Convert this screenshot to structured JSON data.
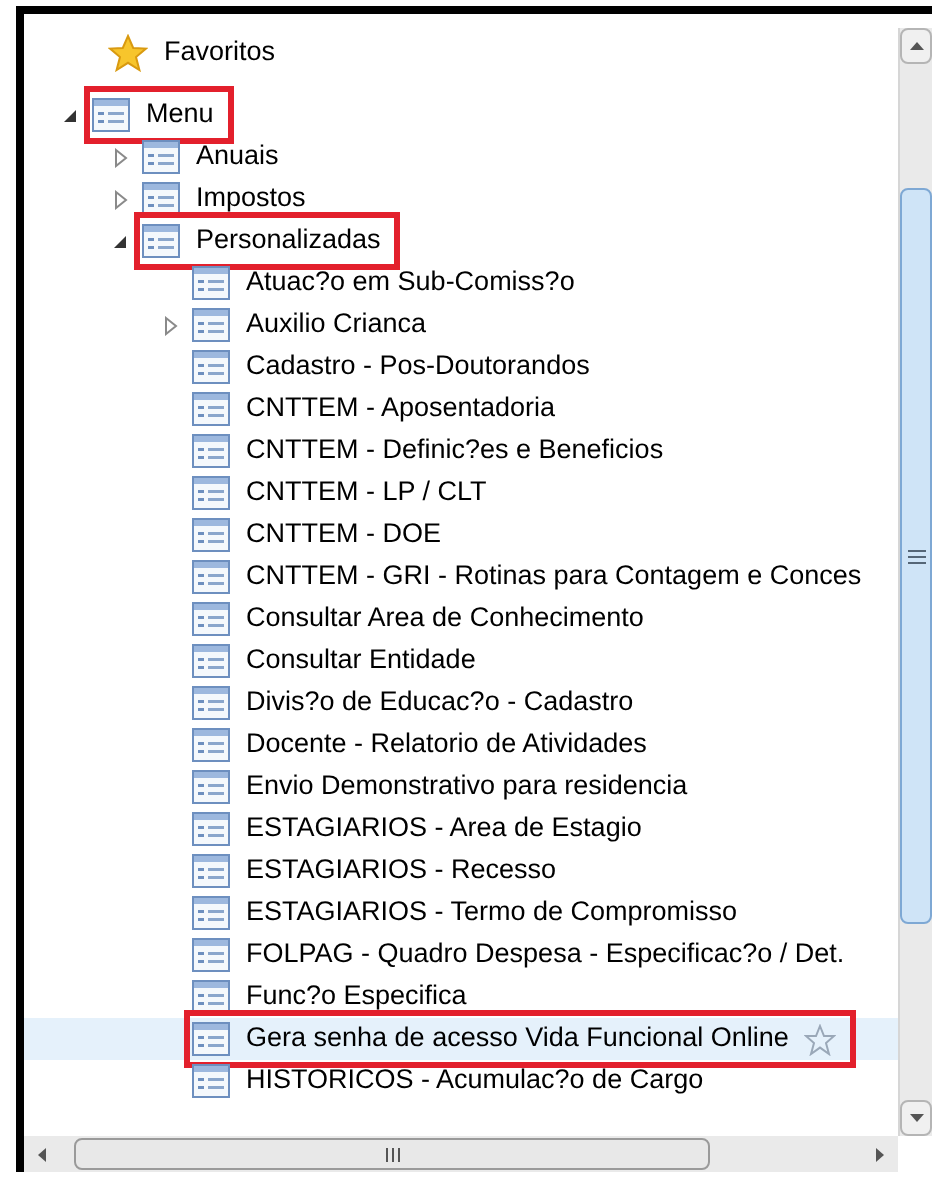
{
  "favorites": {
    "label": "Favoritos"
  },
  "tree": [
    {
      "label": "Menu",
      "kind": "branch",
      "expanded": true,
      "selected": false,
      "annotated": true,
      "children": [
        {
          "label": "Anuais",
          "kind": "branch",
          "expanded": false,
          "selected": false,
          "annotated": false
        },
        {
          "label": "Impostos",
          "kind": "branch",
          "expanded": false,
          "selected": false,
          "annotated": false
        },
        {
          "label": "Personalizadas",
          "kind": "branch",
          "expanded": true,
          "selected": false,
          "annotated": true,
          "children": [
            {
              "label": "Atuac?o em Sub-Comiss?o",
              "kind": "leaf",
              "selected": false,
              "annotated": false
            },
            {
              "label": "Auxilio Crianca",
              "kind": "branch",
              "expanded": false,
              "selected": false,
              "annotated": false
            },
            {
              "label": "Cadastro - Pos-Doutorandos",
              "kind": "leaf",
              "selected": false,
              "annotated": false
            },
            {
              "label": "CNTTEM - Aposentadoria",
              "kind": "leaf",
              "selected": false,
              "annotated": false
            },
            {
              "label": "CNTTEM - Definic?es e Beneficios",
              "kind": "leaf",
              "selected": false,
              "annotated": false
            },
            {
              "label": "CNTTEM - LP / CLT",
              "kind": "leaf",
              "selected": false,
              "annotated": false
            },
            {
              "label": "CNTTEM - DOE",
              "kind": "leaf",
              "selected": false,
              "annotated": false
            },
            {
              "label": "CNTTEM - GRI - Rotinas para Contagem e Conces",
              "kind": "leaf",
              "selected": false,
              "annotated": false
            },
            {
              "label": "Consultar Area de Conhecimento",
              "kind": "leaf",
              "selected": false,
              "annotated": false
            },
            {
              "label": "Consultar Entidade",
              "kind": "leaf",
              "selected": false,
              "annotated": false
            },
            {
              "label": "Divis?o de Educac?o - Cadastro",
              "kind": "leaf",
              "selected": false,
              "annotated": false
            },
            {
              "label": "Docente - Relatorio de Atividades",
              "kind": "leaf",
              "selected": false,
              "annotated": false
            },
            {
              "label": "Envio Demonstrativo para residencia",
              "kind": "leaf",
              "selected": false,
              "annotated": false
            },
            {
              "label": "ESTAGIARIOS - Area de Estagio",
              "kind": "leaf",
              "selected": false,
              "annotated": false
            },
            {
              "label": "ESTAGIARIOS - Recesso",
              "kind": "leaf",
              "selected": false,
              "annotated": false
            },
            {
              "label": "ESTAGIARIOS - Termo de Compromisso",
              "kind": "leaf",
              "selected": false,
              "annotated": false
            },
            {
              "label": "FOLPAG - Quadro Despesa - Especificac?o / Det.",
              "kind": "leaf",
              "selected": false,
              "annotated": false
            },
            {
              "label": "Func?o Especifica",
              "kind": "leaf",
              "selected": false,
              "annotated": false
            },
            {
              "label": "Gera senha de acesso Vida Funcional Online",
              "kind": "leaf",
              "selected": true,
              "annotated": true
            },
            {
              "label": "HISTORICOS - Acumulac?o de Cargo",
              "kind": "leaf",
              "selected": false,
              "annotated": false
            }
          ]
        }
      ]
    }
  ]
}
